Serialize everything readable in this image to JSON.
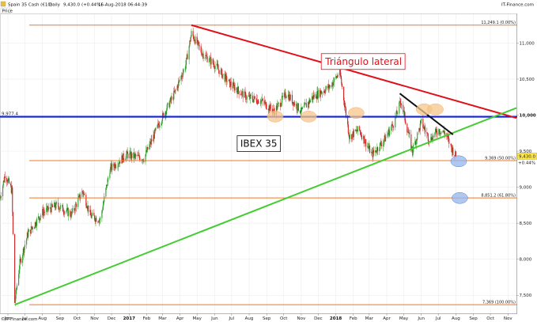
{
  "chart_data": {
    "type": "candlestick",
    "title": "Spain 35 Cash (€10)",
    "timeframe": "Daily",
    "last_price": "9,430.0",
    "change": "(+0.44%)",
    "timestamp": "16-Aug-2018 06:44:39",
    "source": "IT-Finance.com",
    "copyright": "©IT-Finance.com",
    "price_label": "Price",
    "ylim": [
      7250,
      11400
    ],
    "xlim": [
      "2016-06-01",
      "2018-11-30"
    ],
    "y_ticks": [
      {
        "value": 7500,
        "label": "7,500"
      },
      {
        "value": 8000,
        "label": "8,000"
      },
      {
        "value": 8500,
        "label": "8,500"
      },
      {
        "value": 9000,
        "label": "9,000"
      },
      {
        "value": 9500,
        "label": "9,500"
      },
      {
        "value": 10000,
        "label": "10,000"
      },
      {
        "value": 10500,
        "label": "10,500"
      },
      {
        "value": 11000,
        "label": "11,000"
      }
    ],
    "x_ticks": [
      {
        "date": "2016-06-15",
        "label": "Jun"
      },
      {
        "date": "2016-07-15",
        "label": "Jul"
      },
      {
        "date": "2016-08-15",
        "label": "Aug"
      },
      {
        "date": "2016-09-15",
        "label": "Sep"
      },
      {
        "date": "2016-10-15",
        "label": "Oct"
      },
      {
        "date": "2016-11-15",
        "label": "Nov"
      },
      {
        "date": "2016-12-15",
        "label": "Dec"
      },
      {
        "date": "2017-01-15",
        "label": "2017",
        "bold": true
      },
      {
        "date": "2017-02-15",
        "label": "Feb"
      },
      {
        "date": "2017-03-15",
        "label": "Mar"
      },
      {
        "date": "2017-04-15",
        "label": "Apr"
      },
      {
        "date": "2017-05-15",
        "label": "May"
      },
      {
        "date": "2017-06-15",
        "label": "Jun"
      },
      {
        "date": "2017-07-15",
        "label": "Jul"
      },
      {
        "date": "2017-08-15",
        "label": "Aug"
      },
      {
        "date": "2017-09-15",
        "label": "Sep"
      },
      {
        "date": "2017-10-15",
        "label": "Oct"
      },
      {
        "date": "2017-11-15",
        "label": "Nov"
      },
      {
        "date": "2017-12-15",
        "label": "Dec"
      },
      {
        "date": "2018-01-15",
        "label": "2018",
        "bold": true
      },
      {
        "date": "2018-02-15",
        "label": "Feb"
      },
      {
        "date": "2018-03-15",
        "label": "Mar"
      },
      {
        "date": "2018-04-15",
        "label": "Apr"
      },
      {
        "date": "2018-05-15",
        "label": "May"
      },
      {
        "date": "2018-06-15",
        "label": "Jun"
      },
      {
        "date": "2018-07-15",
        "label": "Jul"
      },
      {
        "date": "2018-08-15",
        "label": "Aug"
      },
      {
        "date": "2018-09-15",
        "label": "Sep"
      },
      {
        "date": "2018-10-15",
        "label": "Oct"
      },
      {
        "date": "2018-11-15",
        "label": "Nov"
      }
    ],
    "price_anchors": [
      {
        "date": "2016-06-01",
        "value": 8850
      },
      {
        "date": "2016-06-10",
        "value": 9180
      },
      {
        "date": "2016-06-22",
        "value": 8950
      },
      {
        "date": "2016-06-27",
        "value": 7400
      },
      {
        "date": "2016-07-06",
        "value": 7950
      },
      {
        "date": "2016-07-20",
        "value": 8350
      },
      {
        "date": "2016-08-15",
        "value": 8650
      },
      {
        "date": "2016-09-10",
        "value": 8750
      },
      {
        "date": "2016-10-05",
        "value": 8620
      },
      {
        "date": "2016-10-25",
        "value": 8950
      },
      {
        "date": "2016-11-08",
        "value": 8600
      },
      {
        "date": "2016-11-25",
        "value": 8550
      },
      {
        "date": "2016-12-12",
        "value": 9250
      },
      {
        "date": "2017-01-10",
        "value": 9450
      },
      {
        "date": "2017-02-10",
        "value": 9400
      },
      {
        "date": "2017-03-10",
        "value": 9900
      },
      {
        "date": "2017-04-05",
        "value": 10300
      },
      {
        "date": "2017-04-25",
        "value": 10700
      },
      {
        "date": "2017-05-05",
        "value": 11135
      },
      {
        "date": "2017-05-25",
        "value": 10850
      },
      {
        "date": "2017-06-15",
        "value": 10700
      },
      {
        "date": "2017-07-10",
        "value": 10450
      },
      {
        "date": "2017-08-10",
        "value": 10250
      },
      {
        "date": "2017-09-05",
        "value": 10200
      },
      {
        "date": "2017-09-28",
        "value": 10050
      },
      {
        "date": "2017-10-20",
        "value": 10300
      },
      {
        "date": "2017-11-15",
        "value": 10050
      },
      {
        "date": "2017-12-05",
        "value": 10250
      },
      {
        "date": "2018-01-05",
        "value": 10400
      },
      {
        "date": "2018-01-22",
        "value": 10600
      },
      {
        "date": "2018-02-08",
        "value": 9700
      },
      {
        "date": "2018-02-25",
        "value": 9800
      },
      {
        "date": "2018-03-20",
        "value": 9450
      },
      {
        "date": "2018-04-10",
        "value": 9650
      },
      {
        "date": "2018-04-28",
        "value": 9900
      },
      {
        "date": "2018-05-10",
        "value": 10200
      },
      {
        "date": "2018-05-30",
        "value": 9500
      },
      {
        "date": "2018-06-15",
        "value": 9900
      },
      {
        "date": "2018-06-30",
        "value": 9650
      },
      {
        "date": "2018-07-15",
        "value": 9800
      },
      {
        "date": "2018-07-27",
        "value": 9750
      },
      {
        "date": "2018-08-07",
        "value": 9550
      },
      {
        "date": "2018-08-15",
        "value": 9430
      }
    ],
    "horizontal_levels": [
      {
        "value": 11249.1,
        "label": "11,249.1 (0.00%)",
        "color": "#f07828"
      },
      {
        "value": 9369,
        "label": "9,369 (50.00%)",
        "color": "#f07828"
      },
      {
        "value": 8851.2,
        "label": "8,851.2 (61.80%)",
        "color": "#f07828"
      },
      {
        "value": 7369,
        "label": "7,369 (100.00%)",
        "color": "#f07828"
      }
    ],
    "blue_level": {
      "value": 9977.4,
      "label": "9,977.4",
      "color": "#1020e0"
    },
    "trendlines": [
      {
        "name": "red-resistance",
        "color": "#e0101a",
        "from": {
          "date": "2017-05-05",
          "value": 11249
        },
        "to": {
          "date": "2018-11-30",
          "value": 9960
        }
      },
      {
        "name": "green-support",
        "color": "#44cc33",
        "from": {
          "date": "2016-06-27",
          "value": 7369
        },
        "to": {
          "date": "2018-11-30",
          "value": 10100
        }
      },
      {
        "name": "black-short",
        "color": "#111111",
        "from": {
          "date": "2018-05-08",
          "value": 10300
        },
        "to": {
          "date": "2018-08-10",
          "value": 9730
        }
      }
    ],
    "highlights": [
      {
        "date": "2017-09-30",
        "value": 9980,
        "color": "#f5c58a"
      },
      {
        "date": "2017-11-28",
        "value": 9980,
        "color": "#f5c58a"
      },
      {
        "date": "2018-02-20",
        "value": 10030,
        "color": "#f5c58a"
      },
      {
        "date": "2018-06-20",
        "value": 10080,
        "color": "#f5c58a"
      },
      {
        "date": "2018-07-10",
        "value": 10080,
        "color": "#f5c58a"
      },
      {
        "date": "2018-08-20",
        "value": 9360,
        "color": "#94b6ee"
      },
      {
        "date": "2018-08-22",
        "value": 8850,
        "color": "#94b6ee"
      }
    ],
    "annotations": [
      {
        "text": "Triángulo lateral",
        "color": "#e0101a",
        "date": "2018-03-05",
        "value": 10700,
        "boxed": true
      },
      {
        "text": "IBEX 35",
        "color": "#111111",
        "date": "2017-09-01",
        "value": 9560,
        "boxed": true
      }
    ],
    "colors": {
      "up": "#2a9d2a",
      "down": "#d02020",
      "axis": "#999999",
      "grid": "#e9e9e9"
    }
  }
}
